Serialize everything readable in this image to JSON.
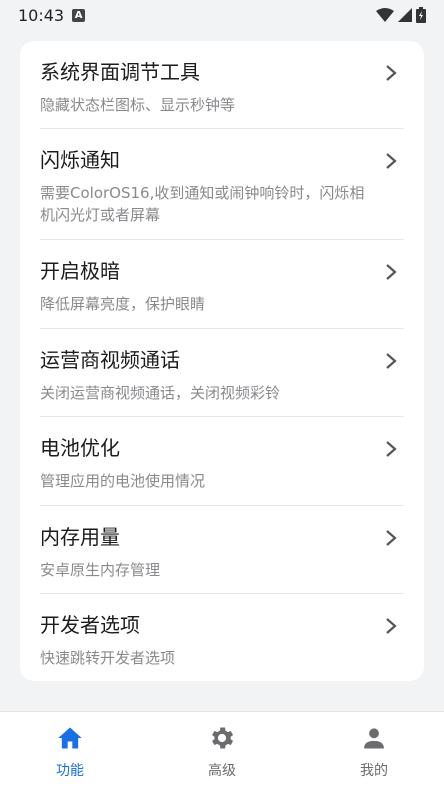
{
  "status_bar": {
    "time": "10:43",
    "notification_badge": "A"
  },
  "menu_items": [
    {
      "title": "系统界面调节工具",
      "desc": "隐藏状态栏图标、显示秒钟等"
    },
    {
      "title": "闪烁通知",
      "desc": "需要ColorOS16,收到通知或闹钟响铃时，闪烁相机闪光灯或者屏幕"
    },
    {
      "title": "开启极暗",
      "desc": "降低屏幕亮度，保护眼睛"
    },
    {
      "title": "运营商视频通话",
      "desc": "关闭运营商视频通话，关闭视频彩铃"
    },
    {
      "title": "电池优化",
      "desc": "管理应用的电池使用情况"
    },
    {
      "title": "内存用量",
      "desc": "安卓原生内存管理"
    },
    {
      "title": "开发者选项",
      "desc": "快速跳转开发者选项"
    }
  ],
  "bottom_nav": [
    {
      "label": "功能",
      "icon": "home-icon",
      "active": true
    },
    {
      "label": "高级",
      "icon": "gear-icon",
      "active": false
    },
    {
      "label": "我的",
      "icon": "person-icon",
      "active": false
    }
  ],
  "colors": {
    "accent": "#1a6fe6",
    "inactive": "#6b6b70",
    "background": "#f2f3f5"
  }
}
